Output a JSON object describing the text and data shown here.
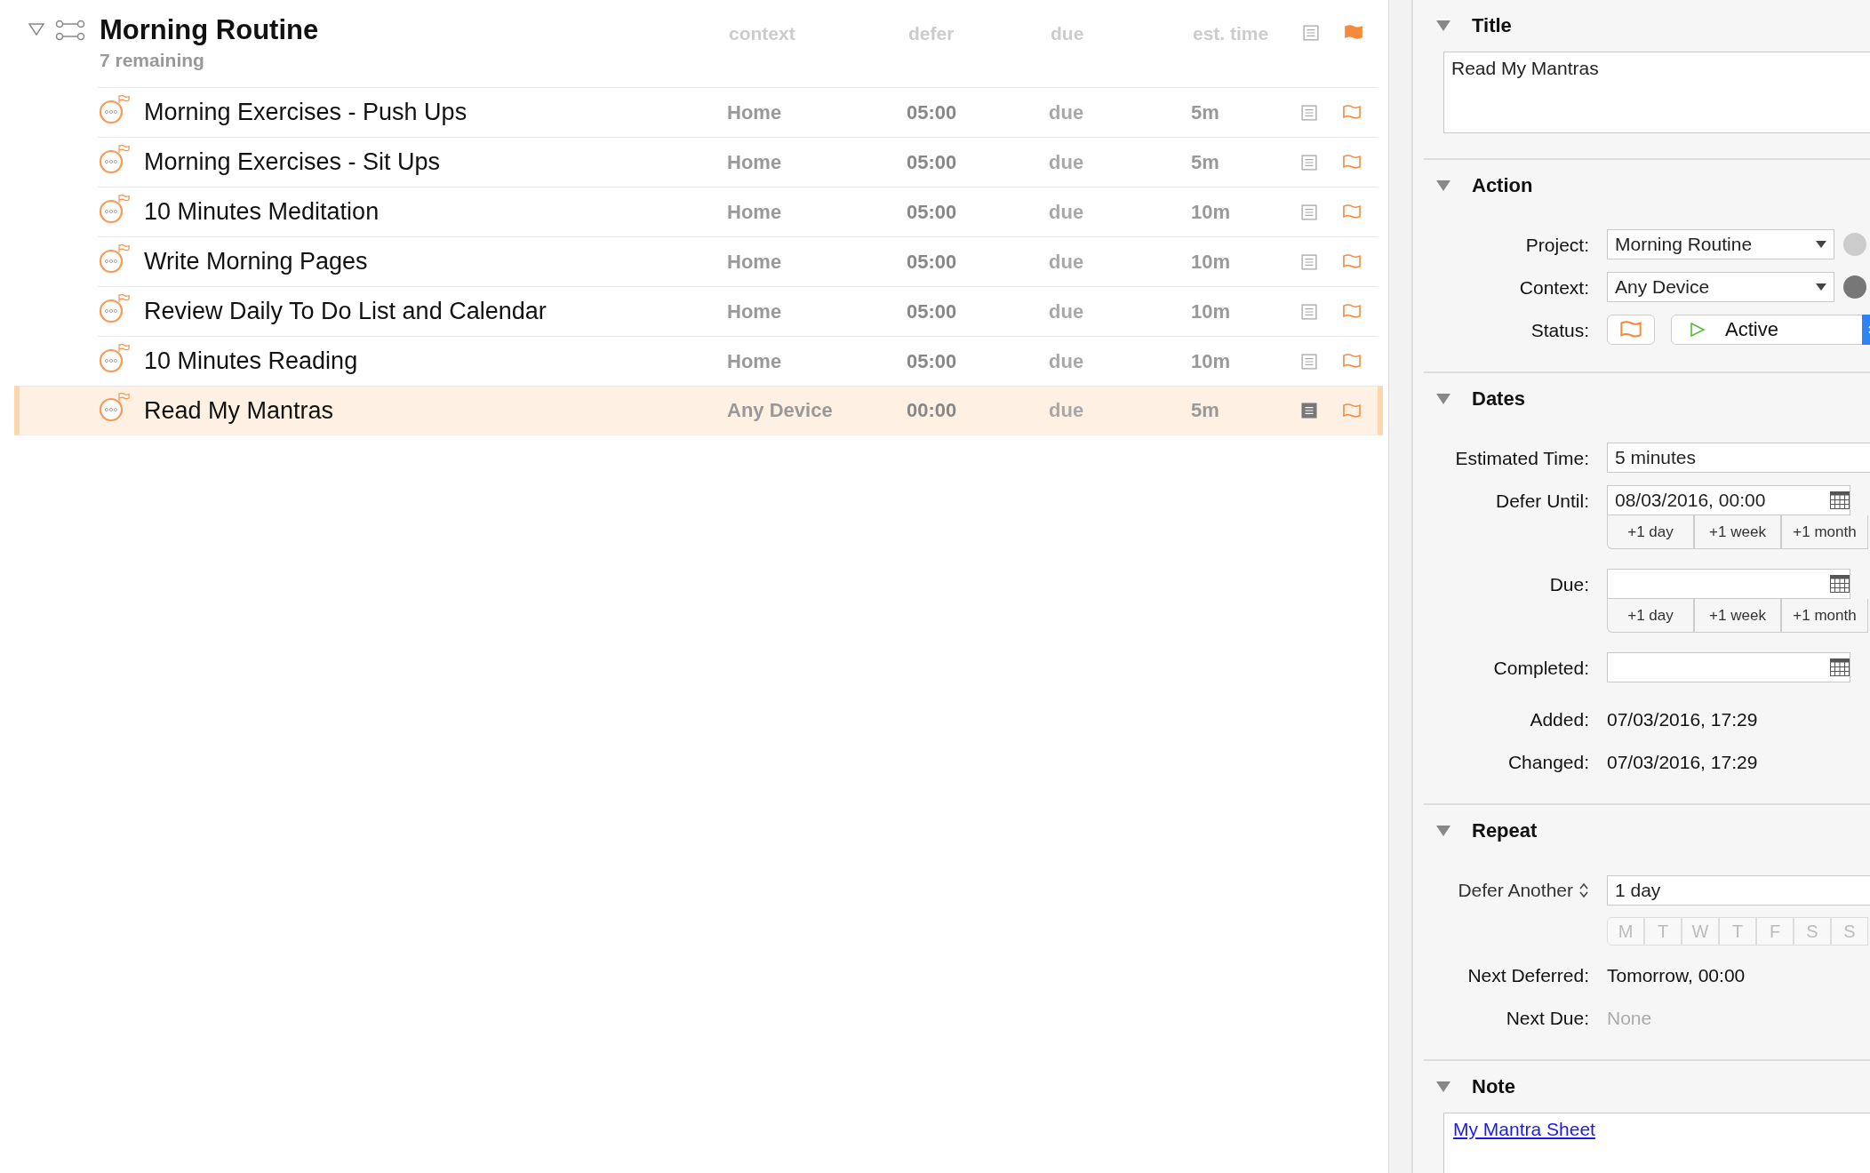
{
  "project": {
    "title": "Morning Routine",
    "remaining": "7 remaining",
    "expanded": true,
    "flagged": true
  },
  "columns": [
    "context",
    "defer",
    "due",
    "est. time"
  ],
  "rows": [
    {
      "title": "Morning Exercises - Push Ups",
      "context": "Home",
      "defer": "05:00",
      "due": "due",
      "est": "5m",
      "has_note": false,
      "flagged": false,
      "selected": false
    },
    {
      "title": "Morning Exercises - Sit Ups",
      "context": "Home",
      "defer": "05:00",
      "due": "due",
      "est": "5m",
      "has_note": false,
      "flagged": false,
      "selected": false
    },
    {
      "title": "10 Minutes Meditation",
      "context": "Home",
      "defer": "05:00",
      "due": "due",
      "est": "10m",
      "has_note": false,
      "flagged": false,
      "selected": false
    },
    {
      "title": "Write Morning Pages",
      "context": "Home",
      "defer": "05:00",
      "due": "due",
      "est": "10m",
      "has_note": false,
      "flagged": false,
      "selected": false
    },
    {
      "title": "Review Daily To Do List and Calendar",
      "context": "Home",
      "defer": "05:00",
      "due": "due",
      "est": "10m",
      "has_note": false,
      "flagged": false,
      "selected": false
    },
    {
      "title": "10 Minutes Reading",
      "context": "Home",
      "defer": "05:00",
      "due": "due",
      "est": "10m",
      "has_note": false,
      "flagged": false,
      "selected": false
    },
    {
      "title": "Read My Mantras",
      "context": "Any Device",
      "defer": "00:00",
      "due": "due",
      "est": "5m",
      "has_note": true,
      "flagged": false,
      "selected": true
    }
  ],
  "title_section": {
    "heading": "Title",
    "expanded": true,
    "value": "Read My Mantras"
  },
  "action": {
    "heading": "Action",
    "expanded": true,
    "project_label": "Project:",
    "project": "Morning Routine",
    "context_label": "Context:",
    "context": "Any Device",
    "status_label": "Status:",
    "flagged": false,
    "status": "Active"
  },
  "dates": {
    "heading": "Dates",
    "expanded": true,
    "fields": [
      {
        "kind": "text",
        "label": "Estimated Time:",
        "value": "5 minutes"
      },
      {
        "kind": "date",
        "label": "Defer Until:",
        "value": "08/03/2016, 00:00",
        "shortcuts": [
          "+1 day",
          "+1 week",
          "+1 month"
        ]
      },
      {
        "kind": "date",
        "label": "Due:",
        "shortcuts": [
          "+1 day",
          "+1 week",
          "+1 month"
        ]
      },
      {
        "kind": "date",
        "label": "Completed:"
      },
      {
        "kind": "info",
        "label": "Added:",
        "value": "07/03/2016, 17:29"
      },
      {
        "kind": "info",
        "label": "Changed:",
        "value": "07/03/2016, 17:29"
      }
    ]
  },
  "repeat": {
    "heading": "Repeat",
    "expanded": true,
    "mode": "Defer Another",
    "interval": "1 day",
    "weekdays": [
      {
        "label": "M",
        "selected": false
      },
      {
        "label": "T",
        "selected": false
      },
      {
        "label": "W",
        "selected": false
      },
      {
        "label": "T",
        "selected": false
      },
      {
        "label": "F",
        "selected": false
      },
      {
        "label": "S",
        "selected": false
      },
      {
        "label": "S",
        "selected": false
      }
    ],
    "next_deferred_label": "Next Deferred:",
    "next_deferred": "Tomorrow, 00:00",
    "next_due_label": "Next Due:",
    "next_due": "None"
  },
  "note": {
    "heading": "Note",
    "expanded": true,
    "link": "My Mantra Sheet"
  }
}
